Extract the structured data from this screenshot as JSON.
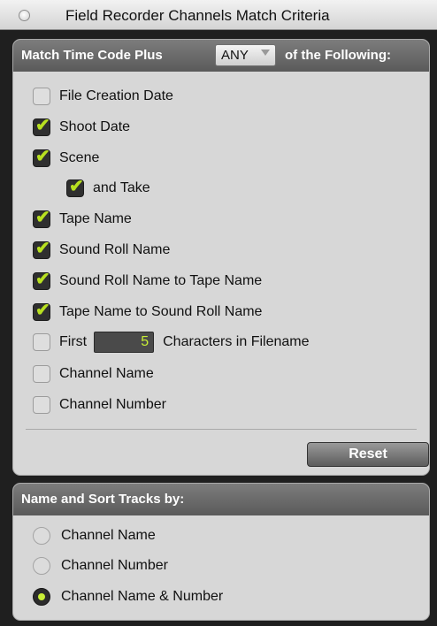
{
  "window": {
    "title": "Field Recorder Channels Match Criteria"
  },
  "match_section": {
    "header_prefix": "Match Time Code Plus",
    "mode_selected": "ANY",
    "header_suffix": "of the Following:",
    "options": [
      {
        "label": "File Creation Date",
        "checked": false
      },
      {
        "label": "Shoot Date",
        "checked": true
      },
      {
        "label": "Scene",
        "checked": true
      },
      {
        "label": "and Take",
        "checked": true
      },
      {
        "label": "Tape Name",
        "checked": true
      },
      {
        "label": "Sound Roll Name",
        "checked": true
      },
      {
        "label": "Sound Roll Name to Tape Name",
        "checked": true
      },
      {
        "label": "Tape Name to Sound Roll Name",
        "checked": true
      },
      {
        "label_before": "First",
        "chars_value": "5",
        "label_after": "Characters in Filename",
        "checked": false
      },
      {
        "label": "Channel Name",
        "checked": false
      },
      {
        "label": "Channel Number",
        "checked": false
      }
    ],
    "reset_label": "Reset"
  },
  "sort_section": {
    "header": "Name and Sort Tracks by:",
    "options": [
      {
        "label": "Channel Name",
        "selected": false
      },
      {
        "label": "Channel Number",
        "selected": false
      },
      {
        "label": "Channel Name & Number",
        "selected": true
      }
    ]
  },
  "colors": {
    "check_accent": "#b8e020",
    "radio_accent": "#c8ee36",
    "header_bg": "#6a6a6a",
    "panel_bg": "#d7d7d7"
  },
  "icons": {
    "window_button": "circle-icon",
    "checkbox_checked": "checkmark-icon",
    "dropdown": "triangle-down-icon",
    "radio_selected": "radio-dot-icon"
  }
}
